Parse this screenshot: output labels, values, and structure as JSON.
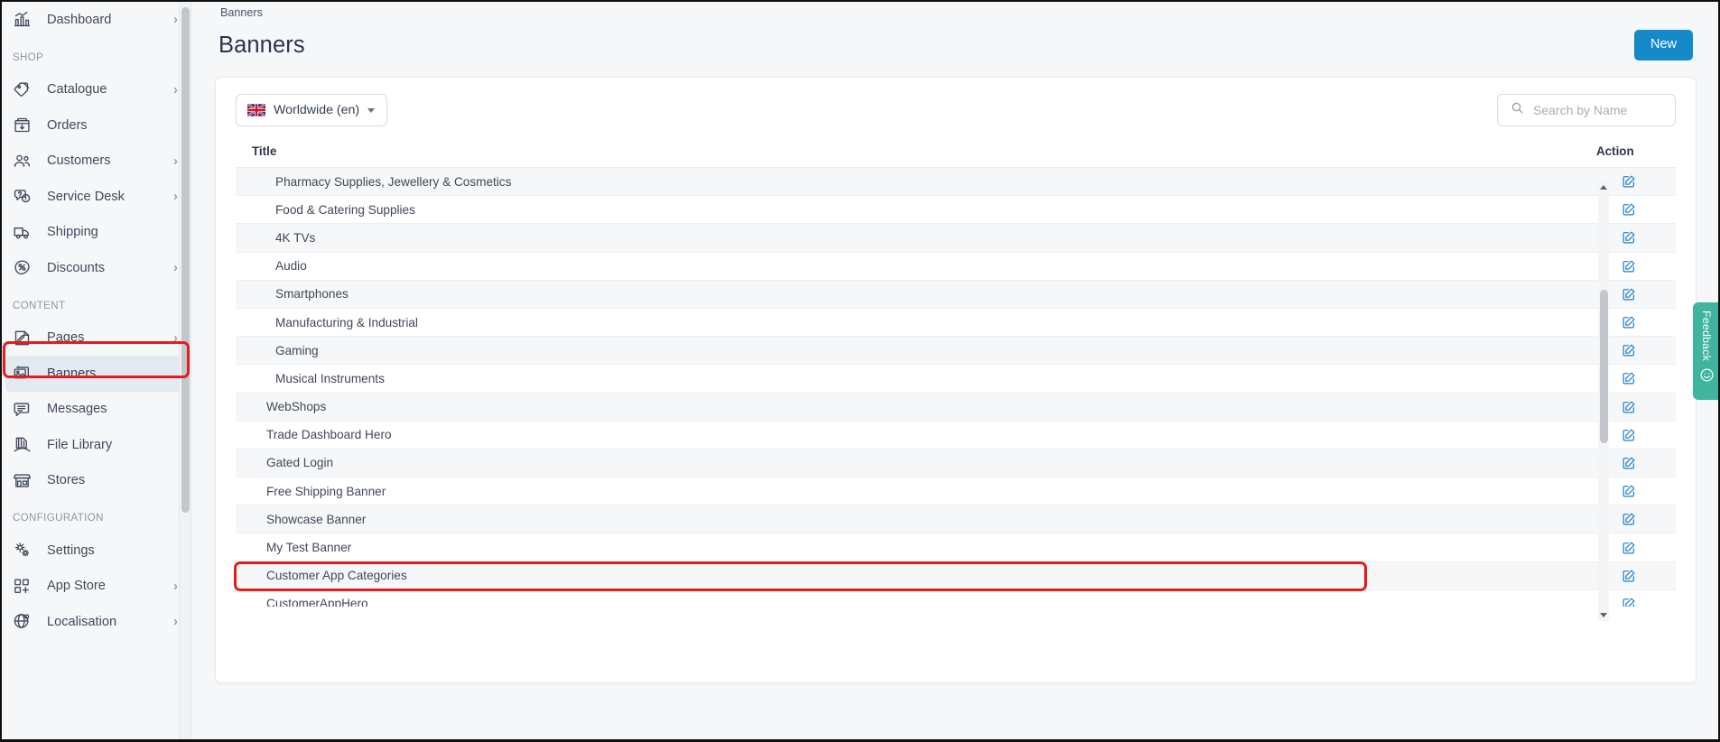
{
  "sidebar": {
    "groups": [
      {
        "label": "",
        "items": [
          {
            "label": "Dashboard",
            "icon": "dashboard-icon",
            "chevron": "›",
            "active": false
          }
        ]
      },
      {
        "label": "SHOP",
        "items": [
          {
            "label": "Catalogue",
            "icon": "tag-icon",
            "chevron": "›",
            "active": false
          },
          {
            "label": "Orders",
            "icon": "box-icon",
            "chevron": "",
            "active": false
          },
          {
            "label": "Customers",
            "icon": "users-icon",
            "chevron": "›",
            "active": false
          },
          {
            "label": "Service Desk",
            "icon": "support-icon",
            "chevron": "›",
            "active": false
          },
          {
            "label": "Shipping",
            "icon": "truck-icon",
            "chevron": "",
            "active": false
          },
          {
            "label": "Discounts",
            "icon": "percent-icon",
            "chevron": "›",
            "active": false
          }
        ]
      },
      {
        "label": "CONTENT",
        "items": [
          {
            "label": "Pages",
            "icon": "page-edit-icon",
            "chevron": "›",
            "active": false
          },
          {
            "label": "Banners",
            "icon": "banners-icon",
            "chevron": "",
            "active": true
          },
          {
            "label": "Messages",
            "icon": "message-icon",
            "chevron": "",
            "active": false
          },
          {
            "label": "File Library",
            "icon": "file-library-icon",
            "chevron": "",
            "active": false
          },
          {
            "label": "Stores",
            "icon": "store-icon",
            "chevron": "",
            "active": false
          }
        ]
      },
      {
        "label": "CONFIGURATION",
        "items": [
          {
            "label": "Settings",
            "icon": "gears-icon",
            "chevron": "",
            "active": false
          },
          {
            "label": "App Store",
            "icon": "apps-icon",
            "chevron": "›",
            "active": false
          },
          {
            "label": "Localisation",
            "icon": "globe-icon",
            "chevron": "›",
            "active": false
          }
        ]
      }
    ]
  },
  "header": {
    "breadcrumb": "Banners",
    "title": "Banners",
    "new_button": "New"
  },
  "toolbar": {
    "locale_label": "Worldwide (en)",
    "locale_flag": "uk-flag-icon",
    "search_placeholder": "Search by Name",
    "search_value": ""
  },
  "table": {
    "columns": [
      "Title",
      "Action"
    ],
    "action_icon": "edit-icon",
    "rows": [
      {
        "title": "Pharmacy Supplies, Jewellery & Cosmetics",
        "indent": true,
        "alt": true,
        "highlighted": false
      },
      {
        "title": "Food & Catering Supplies",
        "indent": true,
        "alt": false,
        "highlighted": false
      },
      {
        "title": "4K TVs",
        "indent": true,
        "alt": true,
        "highlighted": false
      },
      {
        "title": "Audio",
        "indent": true,
        "alt": false,
        "highlighted": false
      },
      {
        "title": "Smartphones",
        "indent": true,
        "alt": true,
        "highlighted": false
      },
      {
        "title": "Manufacturing & Industrial",
        "indent": true,
        "alt": false,
        "highlighted": false
      },
      {
        "title": "Gaming",
        "indent": true,
        "alt": true,
        "highlighted": false
      },
      {
        "title": "Musical Instruments",
        "indent": true,
        "alt": false,
        "highlighted": false
      },
      {
        "title": "WebShops",
        "indent": false,
        "alt": true,
        "highlighted": false
      },
      {
        "title": "Trade Dashboard Hero",
        "indent": false,
        "alt": false,
        "highlighted": false
      },
      {
        "title": "Gated Login",
        "indent": false,
        "alt": true,
        "highlighted": false
      },
      {
        "title": "Free Shipping Banner",
        "indent": false,
        "alt": false,
        "highlighted": false
      },
      {
        "title": "Showcase Banner",
        "indent": false,
        "alt": true,
        "highlighted": false
      },
      {
        "title": "My Test Banner",
        "indent": false,
        "alt": false,
        "highlighted": false
      },
      {
        "title": "Customer App Categories",
        "indent": false,
        "alt": true,
        "highlighted": true
      },
      {
        "title": "CustomerAppHero",
        "indent": false,
        "alt": false,
        "highlighted": false
      }
    ]
  },
  "feedback": {
    "label": "Feedback",
    "icon": "smiley-icon"
  },
  "colors": {
    "accent": "#1689ca",
    "annotation": "#e81b1b",
    "feedback": "#3fb5a0",
    "edit_icon": "#1f7fc4",
    "active_nav": "#e3eaf2"
  }
}
